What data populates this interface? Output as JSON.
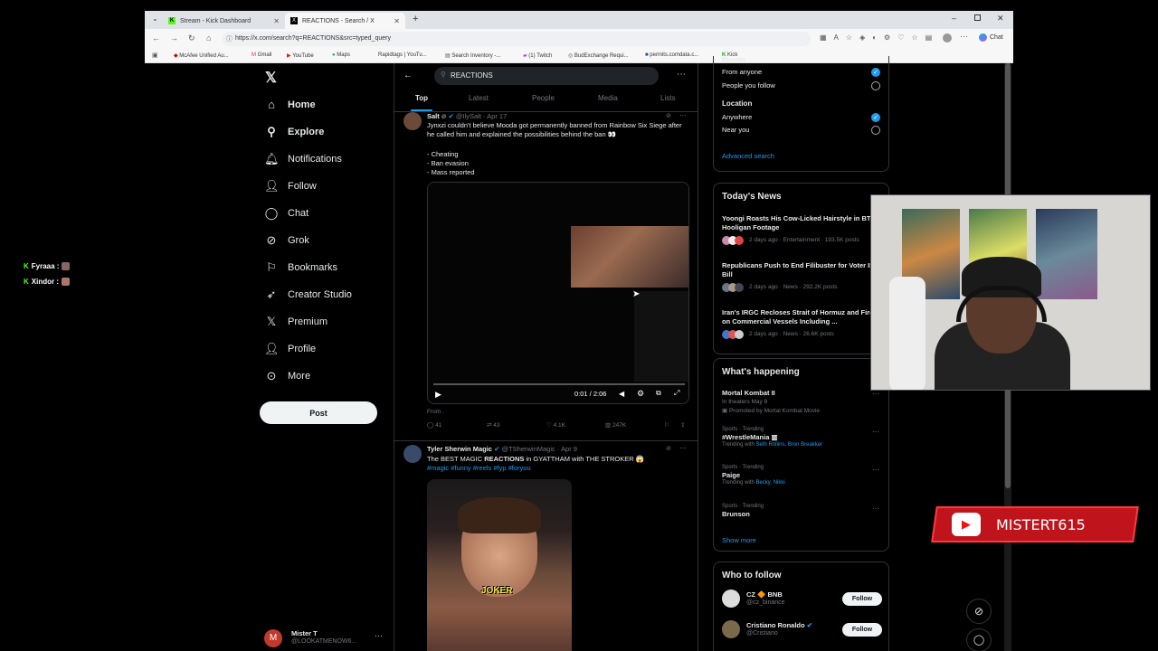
{
  "browser": {
    "tabs": [
      {
        "title": "Stream - Kick Dashboard"
      },
      {
        "title": "REACTIONS - Search / X"
      }
    ],
    "url": "https://x.com/search?q=REACTIONS&src=typed_query",
    "edge_chat": "Chat",
    "bookmarks": [
      "McAfee Unified Au...",
      "Gmail",
      "YouTube",
      "Maps",
      "Rapidtags | YouTu...",
      "Search Inventory -...",
      "(1) Twitch",
      "BudExchange Requi...",
      "permits.comdata.c...",
      "Kick"
    ]
  },
  "overlay": {
    "chat": [
      {
        "name": "Fyraaa :"
      },
      {
        "name": "Xindor :"
      }
    ],
    "channel_name": "MISTERT615"
  },
  "sidebar": {
    "items": [
      {
        "label": "Home",
        "icon": "home-icon"
      },
      {
        "label": "Explore",
        "icon": "search-icon"
      },
      {
        "label": "Notifications",
        "icon": "bell-icon"
      },
      {
        "label": "Follow",
        "icon": "add-user-icon"
      },
      {
        "label": "Chat",
        "icon": "chat-icon"
      },
      {
        "label": "Grok",
        "icon": "grok-icon"
      },
      {
        "label": "Bookmarks",
        "icon": "bookmark-icon"
      },
      {
        "label": "Creator Studio",
        "icon": "rocket-icon"
      },
      {
        "label": "Premium",
        "icon": "x-icon"
      },
      {
        "label": "Profile",
        "icon": "user-icon"
      },
      {
        "label": "More",
        "icon": "more-icon"
      }
    ],
    "post_label": "Post",
    "account": {
      "name": "Mister T",
      "handle": "@LOOKATMENOW6...",
      "initial": "M"
    }
  },
  "search": {
    "query": "REACTIONS",
    "tabs": [
      "Top",
      "Latest",
      "People",
      "Media",
      "Lists"
    ]
  },
  "tweets": [
    {
      "name": "Salt",
      "handle": "@IlySalt",
      "date": "Apr 17",
      "text": "Jynxzi couldn't believe Mooda got permanently banned from Rainbow Six Siege after he called him and explained the possibilities behind the ban 👀",
      "list": [
        "- Cheating",
        "- Ban evasion",
        "- Mass reported"
      ],
      "video_time": "0:01 / 2:06",
      "from": "From .",
      "replies": "41",
      "reposts": "43",
      "likes": "4.1K",
      "views": "247K"
    },
    {
      "name": "Tyler Sherwin Magic",
      "handle": "@TSherwinMagic",
      "date": "Apr 9",
      "text_before": "The BEST MAGIC ",
      "text_bold": "REACTIONS",
      "text_after": " in GYATTHAM with THE STROKER 😱",
      "hashtags": "#magic #funny #reels #fyp #foryou",
      "caption": "JOKER"
    }
  ],
  "filters": {
    "people_header": "People",
    "people_options": [
      "From anyone",
      "People you follow"
    ],
    "location_header": "Location",
    "location_options": [
      "Anywhere",
      "Near you"
    ],
    "advanced": "Advanced search"
  },
  "news": {
    "title": "Today's News",
    "items": [
      {
        "headline": "Yoongi Roasts His Cow-Licked Hairstyle in BTS Hooligan Footage",
        "meta": "2 days ago · Entertainment · 193.5K posts"
      },
      {
        "headline": "Republicans Push to End Filibuster for Voter ID Bill",
        "meta": "2 days ago · News · 292.2K posts"
      },
      {
        "headline": "Iran's IRGC Recloses Strait of Hormuz and Fires on Commercial Vessels Including ...",
        "meta": "2 days ago · News · 26.6K posts"
      }
    ]
  },
  "happening": {
    "title": "What's happening",
    "promo": {
      "title": "Mortal Kombat II",
      "sub": "In theaters May 8",
      "promoted": "Promoted by Mortal Kombat Movie"
    },
    "trends": [
      {
        "context": "Sports · Trending",
        "name": "#WrestleMania",
        "with_label": "Trending with",
        "with": "Seth Rollins, Bron Breakker"
      },
      {
        "context": "Sports · Trending",
        "name": "Paige",
        "with_label": "Trending with",
        "with": "Becky, Nikki"
      },
      {
        "context": "Sports · Trending",
        "name": "Brunson",
        "with_label": "",
        "with": ""
      }
    ],
    "show_more": "Show more"
  },
  "who_to_follow": {
    "title": "Who to follow",
    "accounts": [
      {
        "name": "CZ 🔶 BNB",
        "handle": "@cz_binance",
        "button": "Follow"
      },
      {
        "name": "Cristiano Ronaldo",
        "handle": "@Cristiano",
        "button": "Follow"
      }
    ]
  },
  "colors": {
    "accent": "#1d9bf0",
    "kick": "#53fc18",
    "youtube_red": "#e11"
  }
}
